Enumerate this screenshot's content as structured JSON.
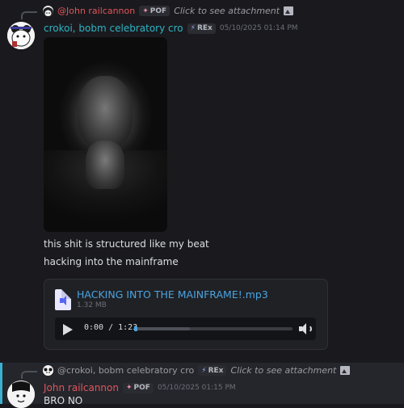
{
  "message1": {
    "reply": {
      "author": "@John railcannon",
      "tag": "POF",
      "preview": "Click to see attachment"
    },
    "author": "crokoi, bobm celebratory cro",
    "author_color": "#2fb3c4",
    "tag": "REx",
    "timestamp": "05/10/2025 01:14 PM",
    "lines": [
      "this shit is structured like my beat",
      "hacking into the mainframe"
    ],
    "attachment": {
      "filename": "HACKING INTO THE MAINFRAME!.mp3",
      "size": "1.32 MB",
      "time": "0:00 / 1:23"
    }
  },
  "message2": {
    "reply": {
      "author": "@crokoi, bobm celebratory cro",
      "tag": "REx",
      "preview": "Click to see attachment"
    },
    "author": "John railcannon",
    "author_color": "#e0555a",
    "tag": "POF",
    "timestamp": "05/10/2025 01:15 PM",
    "text": "BRO NO"
  },
  "icons": {
    "tag_pof": "sparkle-icon",
    "tag_rex": "lightning-icon",
    "image": "image-icon",
    "file": "audio-file-icon",
    "play": "play-icon",
    "volume": "volume-icon"
  },
  "colors": {
    "link": "#4aa3e0",
    "highlight_bar": "#3bb0d0"
  }
}
